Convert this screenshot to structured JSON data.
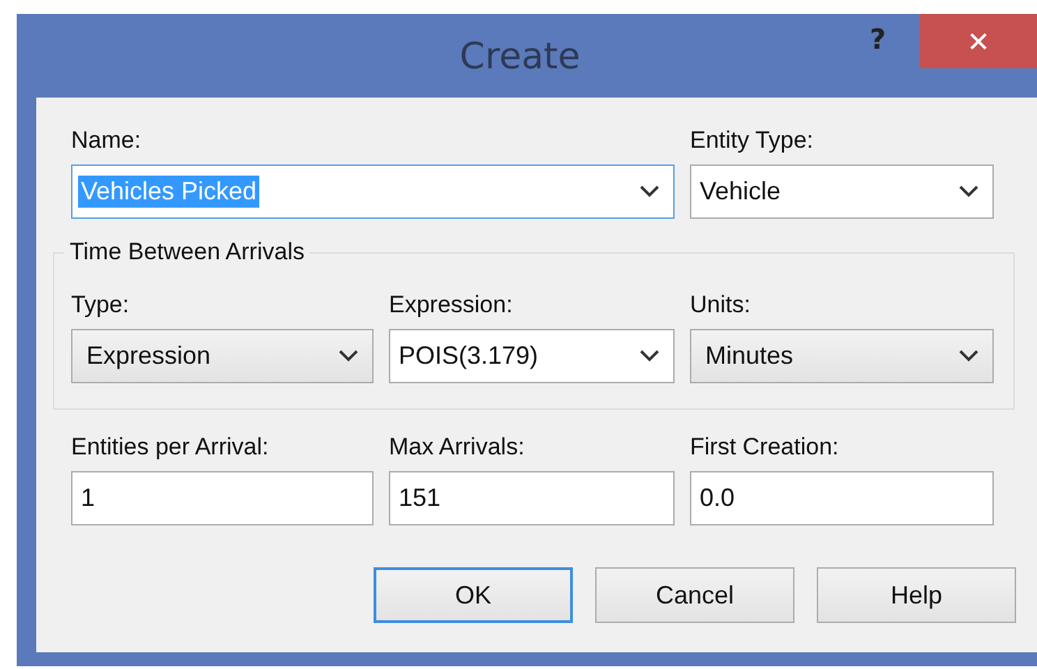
{
  "window": {
    "title": "Create",
    "help_button": "?",
    "close_button": "✕"
  },
  "top_fields": [
    {
      "label": "Name:",
      "kind": "combo",
      "value": "Vehicles Picked",
      "text_selected": true,
      "wide": true
    },
    {
      "label": "Entity Type:",
      "kind": "combo",
      "value": "Vehicle",
      "text_selected": false,
      "wide": false
    }
  ],
  "group": {
    "title": "Time Between Arrivals",
    "fields": [
      {
        "label": "Type:",
        "kind": "dropdown",
        "value": "Expression"
      },
      {
        "label": "Expression:",
        "kind": "combo",
        "value": "POIS(3.179)"
      },
      {
        "label": "Units:",
        "kind": "dropdown",
        "value": "Minutes"
      }
    ]
  },
  "bottom_fields": [
    {
      "label": "Entities per Arrival:",
      "kind": "text",
      "value": "1"
    },
    {
      "label": "Max Arrivals:",
      "kind": "text",
      "value": "151"
    },
    {
      "label": "First Creation:",
      "kind": "text",
      "value": "0.0"
    }
  ],
  "buttons": [
    {
      "label": "OK",
      "default": true
    },
    {
      "label": "Cancel",
      "default": false
    },
    {
      "label": "Help",
      "default": false
    }
  ]
}
